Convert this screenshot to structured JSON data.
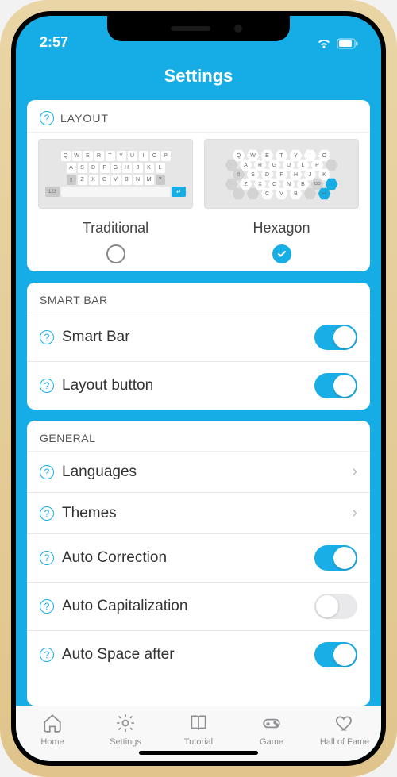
{
  "status": {
    "time": "2:57"
  },
  "nav": {
    "title": "Settings"
  },
  "layout": {
    "header": "LAYOUT",
    "options": {
      "traditional": {
        "label": "Traditional",
        "selected": false
      },
      "hexagon": {
        "label": "Hexagon",
        "selected": true
      }
    },
    "trad_rows": [
      [
        "Q",
        "W",
        "E",
        "R",
        "T",
        "Y",
        "U",
        "I",
        "O",
        "P"
      ],
      [
        "A",
        "S",
        "D",
        "F",
        "G",
        "H",
        "J",
        "K",
        "L"
      ],
      [
        "Z",
        "X",
        "C",
        "V",
        "B",
        "N",
        "M"
      ]
    ],
    "hex_rows": [
      [
        "Q",
        "W",
        "E",
        "T",
        "Y",
        "I",
        "O"
      ],
      [
        "A",
        "R",
        "G",
        "U",
        "L",
        "P"
      ],
      [
        "S",
        "D",
        "F",
        "H",
        "J",
        "K"
      ],
      [
        "Z",
        "X",
        "C",
        "V",
        "N",
        "B"
      ]
    ]
  },
  "smart_bar": {
    "header": "SMART BAR",
    "rows": {
      "smart_bar": {
        "label": "Smart Bar",
        "on": true
      },
      "layout_button": {
        "label": "Layout button",
        "on": true
      }
    }
  },
  "general": {
    "header": "GENERAL",
    "rows": {
      "languages": {
        "label": "Languages",
        "type": "nav"
      },
      "themes": {
        "label": "Themes",
        "type": "nav"
      },
      "auto_correction": {
        "label": "Auto Correction",
        "type": "toggle",
        "on": true
      },
      "auto_capitalization": {
        "label": "Auto Capitalization",
        "type": "toggle",
        "on": false
      },
      "auto_space_after": {
        "label": "Auto Space after",
        "type": "toggle",
        "on": true
      }
    }
  },
  "tabs": {
    "home": "Home",
    "settings": "Settings",
    "tutorial": "Tutorial",
    "game": "Game",
    "hof": "Hall of Fame"
  }
}
